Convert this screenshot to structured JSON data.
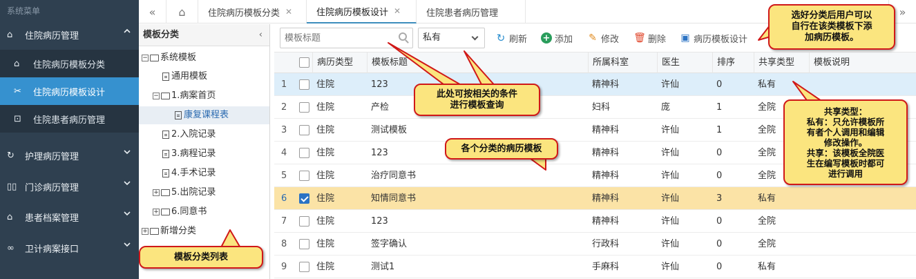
{
  "sidebar": {
    "header": "系统菜单",
    "groups": [
      {
        "label": "住院病历管理",
        "icon": "home-icon"
      },
      {
        "label": "护理病历管理",
        "icon": "refresh-icon"
      },
      {
        "label": "门诊病历管理",
        "icon": "book-icon"
      },
      {
        "label": "患者档案管理",
        "icon": "home-icon"
      },
      {
        "label": "卫计病案接口",
        "icon": "link-icon"
      }
    ],
    "subitems": [
      {
        "label": "住院病历模板分类",
        "icon": "home-icon"
      },
      {
        "label": "住院病历模板设计",
        "icon": "tools-icon",
        "active": true
      },
      {
        "label": "住院患者病历管理",
        "icon": "lock-icon"
      }
    ]
  },
  "tabs": [
    {
      "label": "住院病历模板分类"
    },
    {
      "label": "住院病历模板设计",
      "active": true
    },
    {
      "label": "住院患者病历管理"
    }
  ],
  "tree": {
    "title": "模板分类",
    "collapse_icon": "‹",
    "nodes": [
      {
        "label": "系统模板"
      },
      {
        "label": "通用模板"
      },
      {
        "label": "1.病案首页"
      },
      {
        "label": "康复课程表",
        "selected": true
      },
      {
        "label": "2.入院记录"
      },
      {
        "label": "3.病程记录"
      },
      {
        "label": "4.手术记录"
      },
      {
        "label": "5.出院记录"
      },
      {
        "label": "6.同意书"
      },
      {
        "label": "新增分类"
      }
    ]
  },
  "toolbar": {
    "search_placeholder": "模板标题",
    "select_value": "私有",
    "refresh_label": "刷新",
    "add_label": "添加",
    "edit_label": "修改",
    "delete_label": "删除",
    "design_label": "病历模板设计"
  },
  "table": {
    "columns": [
      "病历类型",
      "模板标题",
      "所属科室",
      "医生",
      "排序",
      "共享类型",
      "模板说明"
    ],
    "rows": [
      {
        "n": "1",
        "type": "住院",
        "title": "123",
        "dept": "精神科",
        "doctor": "许仙",
        "order": "0",
        "share": "私有",
        "checked": false,
        "state": "hover"
      },
      {
        "n": "2",
        "type": "住院",
        "title": "产检",
        "dept": "妇科",
        "doctor": "庞",
        "order": "1",
        "share": "全院",
        "checked": false,
        "state": ""
      },
      {
        "n": "3",
        "type": "住院",
        "title": "测试模板",
        "dept": "精神科",
        "doctor": "许仙",
        "order": "1",
        "share": "全院",
        "checked": false,
        "state": ""
      },
      {
        "n": "4",
        "type": "住院",
        "title": "123",
        "dept": "精神科",
        "doctor": "许仙",
        "order": "0",
        "share": "全院",
        "checked": false,
        "state": ""
      },
      {
        "n": "5",
        "type": "住院",
        "title": "治疗同意书",
        "dept": "精神科",
        "doctor": "许仙",
        "order": "0",
        "share": "全院",
        "checked": false,
        "state": ""
      },
      {
        "n": "6",
        "type": "住院",
        "title": "知情同意书",
        "dept": "精神科",
        "doctor": "许仙",
        "order": "3",
        "share": "私有",
        "checked": true,
        "state": "selected"
      },
      {
        "n": "7",
        "type": "住院",
        "title": "123",
        "dept": "精神科",
        "doctor": "许仙",
        "order": "0",
        "share": "全院",
        "checked": false,
        "state": ""
      },
      {
        "n": "8",
        "type": "住院",
        "title": "签字确认",
        "dept": "行政科",
        "doctor": "许仙",
        "order": "0",
        "share": "全院",
        "checked": false,
        "state": ""
      },
      {
        "n": "9",
        "type": "住院",
        "title": "测试1",
        "dept": "手麻科",
        "doctor": "许仙",
        "order": "0",
        "share": "私有",
        "checked": false,
        "state": ""
      }
    ]
  },
  "callouts": {
    "top_right": "选好分类后用户可以\n自行在该类模板下添\n加病历模板。",
    "query": "此处可按相关的条件\n进行模板查询",
    "templates": "各个分类的病历模板",
    "share": "共享类型：\n私有：只允许模板所\n有者个人调用和编辑\n修改操作。\n共享：该模板全院医\n生在编写模板时都可\n进行调用",
    "tree_list": "模板分类列表"
  },
  "colors": {
    "sidebar_bg": "#2f4050",
    "active_blue": "#3691cf",
    "callout_fill": "#fbe57f",
    "callout_border": "#d01818",
    "selected_row": "#fbe3a6",
    "hover_row": "#ddeefa"
  }
}
